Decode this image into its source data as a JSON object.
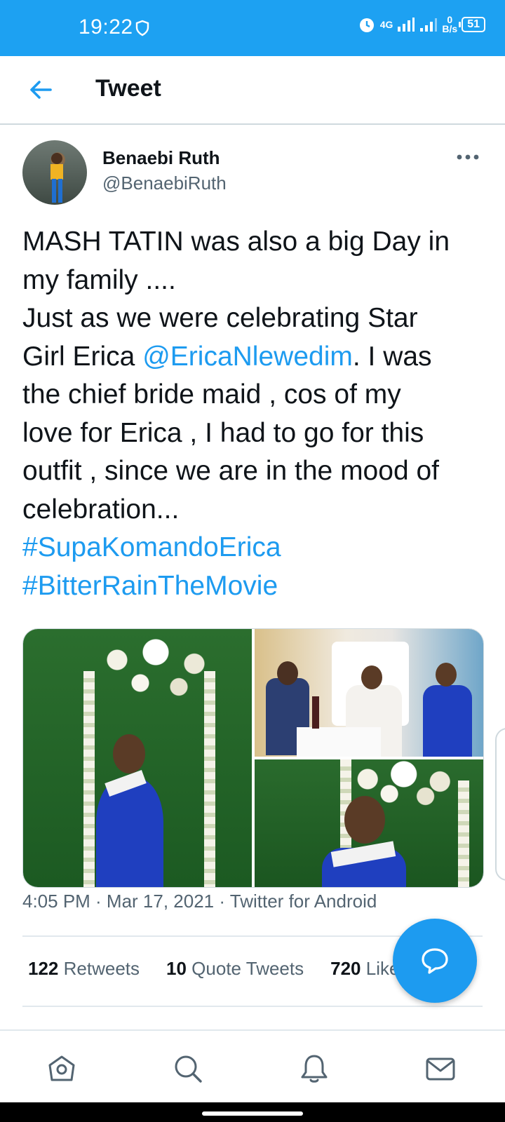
{
  "status_bar": {
    "time": "19:22",
    "network": "4G",
    "data_rate_value": "0",
    "data_rate_unit": "B/s",
    "battery": "51"
  },
  "header": {
    "title": "Tweet"
  },
  "tweet": {
    "author_name": "Benaebi Ruth",
    "author_handle": "@BenaebiRuth",
    "text_lines": [
      "MASH TATIN was also a big Day in",
      "my family ....",
      "Just as we were celebrating Star",
      "Girl Erica ",
      "the chief bride maid , cos of my",
      "love for Erica , I had to go for this",
      "outfit , since we are in the mood of",
      "celebration..."
    ],
    "mention": "@EricaNlewedim",
    "after_mention": ".  I was",
    "hashtags": [
      "#SupaKomandoErica",
      "#BitterRainTheMovie"
    ],
    "timestamp": "4:05 PM · Mar 17, 2021 · Twitter for Android"
  },
  "stats": {
    "retweets_count": "122",
    "retweets_label": "Retweets",
    "quotes_count": "10",
    "quotes_label": "Quote Tweets",
    "likes_count": "720",
    "likes_label": "Likes"
  },
  "colors": {
    "brand": "#1da1f2",
    "link": "#1d9bf0",
    "text": "#0f1419",
    "secondary": "#536471"
  },
  "icons": {
    "back": "arrow-left-icon",
    "more": "more-horizontal-icon",
    "compose": "reply-bubble-icon",
    "nav": [
      "home-icon",
      "search-icon",
      "bell-icon",
      "mail-icon"
    ]
  }
}
